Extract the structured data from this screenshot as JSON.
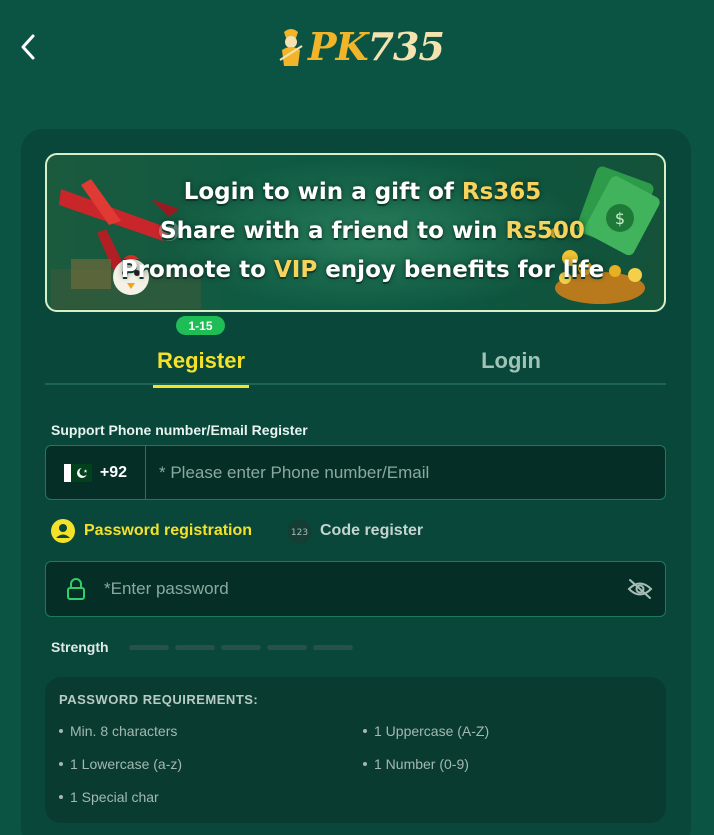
{
  "header": {
    "back_label": "Back",
    "logo_brand": "PK",
    "logo_number": "735"
  },
  "banner": {
    "line1_text": "Login to win a gift of ",
    "line1_highlight": "Rs365",
    "line2_text": "Share with a friend to win ",
    "line2_highlight": "Rs500",
    "line3_pre": "Promote to ",
    "line3_highlight": "VIP",
    "line3_post": " enjoy benefits for life"
  },
  "tabs": {
    "age_badge": "1-15",
    "register_label": "Register",
    "login_label": "Login",
    "active": "Register"
  },
  "phone": {
    "label": "Support Phone number/Email Register",
    "country_code": "+92",
    "country_flag": "pakistan-flag",
    "placeholder": "* Please enter Phone number/Email",
    "value": ""
  },
  "modes": {
    "password_label": "Password registration",
    "code_label": "Code register",
    "code_icon_text": "123",
    "selected": "Password registration"
  },
  "password": {
    "placeholder": "*Enter password",
    "value": ""
  },
  "strength": {
    "label": "Strength",
    "level": 0,
    "segments": 5
  },
  "requirements": {
    "title": "PASSWORD REQUIREMENTS:",
    "items": [
      "Min. 8 characters",
      "1 Uppercase (A-Z)",
      "1 Lowercase (a-z)",
      "1 Number (0-9)",
      "1 Special char"
    ]
  },
  "colors": {
    "background": "#0b5444",
    "card": "#08473a",
    "accent_yellow": "#f4e12a",
    "badge_green": "#1fbd55",
    "input_bg": "#052f26"
  }
}
